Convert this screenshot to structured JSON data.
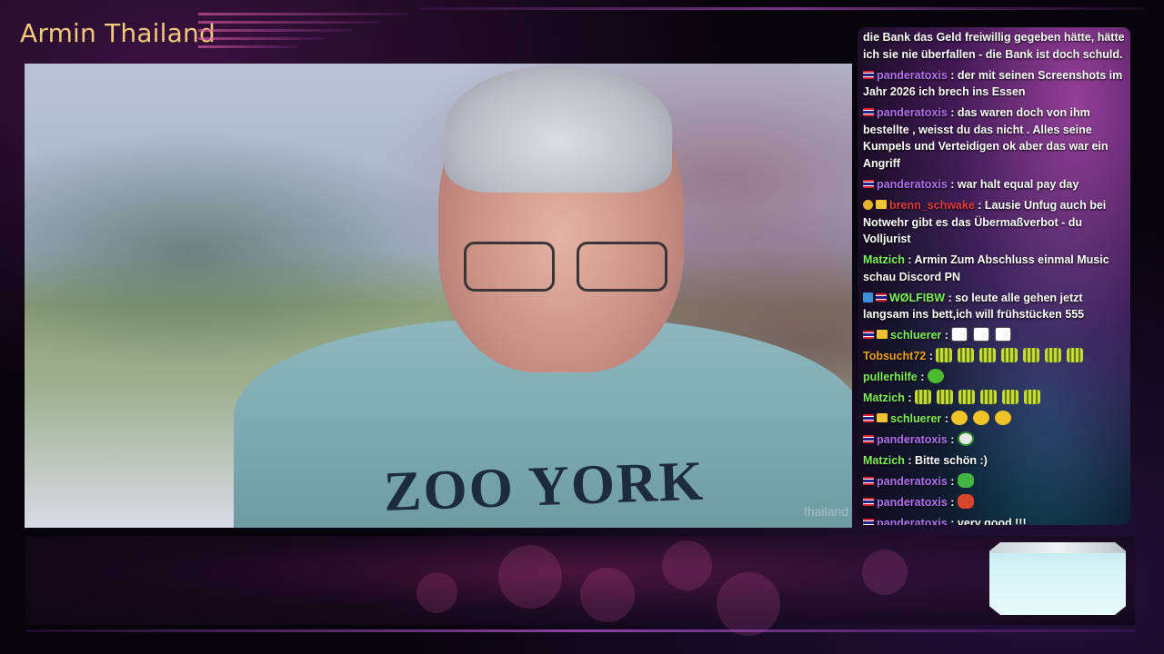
{
  "stream": {
    "title": "Armin Thailand",
    "watermark": "thailand",
    "shirt_text": "ZOO YORK"
  },
  "colors": {
    "title": "#f2c87a",
    "username_purple": "#b070f0",
    "username_green": "#7ff05a",
    "username_red": "#e23b3b",
    "username_orange": "#f0a020"
  },
  "chat": {
    "messages": [
      {
        "badges": [],
        "user": "",
        "color": "",
        "text": "die Bank das Geld freiwillig gegeben hätte, hätte ich sie nie überfallen - die Bank ist doch schuld."
      },
      {
        "badges": [
          "flag-th"
        ],
        "user": "panderatoxis",
        "color": "#b070f0",
        "text": " : der mit seinen Screenshots im Jahr 2026 ich brech ins Essen"
      },
      {
        "badges": [
          "flag-th"
        ],
        "user": "panderatoxis",
        "color": "#b070f0",
        "text": " : das waren doch von ihm bestellte , weisst du das nicht . Alles seine Kumpels und Verteidigen ok aber das war ein Angriff"
      },
      {
        "badges": [
          "flag-th"
        ],
        "user": "panderatoxis",
        "color": "#b070f0",
        "text": " : war halt equal pay day"
      },
      {
        "badges": [
          "badge-gold",
          "badge-crown"
        ],
        "user": "brenn_schwake",
        "color": "#e23b3b",
        "text": " : Lausie Unfug auch bei Notwehr gibt es das Übermaßverbot - du Volljurist"
      },
      {
        "badges": [],
        "user": "Matzich",
        "color": "#7ff05a",
        "text": " : Armin Zum Abschluss einmal Music schau Discord PN"
      },
      {
        "badges": [
          "badge-blue",
          "flag-th"
        ],
        "user": "WØLFIBW",
        "color": "#7ff05a",
        "text": " : so leute alle gehen jetzt langsam ins bett,ich will frühstücken 555"
      },
      {
        "badges": [
          "flag-th",
          "badge-crown"
        ],
        "user": "schluerer",
        "color": "#7ff05a",
        "text": " : ",
        "emotes": [
          "emote-cube",
          "emote-cube",
          "emote-cube"
        ]
      },
      {
        "badges": [],
        "user": "Tobsucht72",
        "color": "#f0a020",
        "text": " : ",
        "emotes": [
          "emote-bars",
          "emote-bars",
          "emote-bars",
          "emote-bars",
          "emote-bars",
          "emote-bars",
          "emote-bars"
        ]
      },
      {
        "badges": [],
        "user": "pullerhilfe",
        "color": "#7ff05a",
        "text": " : ",
        "emotes": [
          "emote-green"
        ]
      },
      {
        "badges": [],
        "user": "Matzich",
        "color": "#7ff05a",
        "text": " : ",
        "emotes": [
          "emote-bars",
          "emote-bars",
          "emote-bars",
          "emote-bars",
          "emote-bars",
          "emote-bars"
        ]
      },
      {
        "badges": [
          "flag-th",
          "badge-crown"
        ],
        "user": "schluerer",
        "color": "#7ff05a",
        "text": " : ",
        "emotes": [
          "emote-yellow",
          "emote-yellow",
          "emote-yellow"
        ]
      },
      {
        "badges": [
          "flag-th"
        ],
        "user": "panderatoxis",
        "color": "#b070f0",
        "text": " : ",
        "emotes": [
          "emote-face"
        ]
      },
      {
        "badges": [],
        "user": "Matzich",
        "color": "#7ff05a",
        "text": " : Bitte schön :)"
      },
      {
        "badges": [
          "flag-th"
        ],
        "user": "panderatoxis",
        "color": "#b070f0",
        "text": " : ",
        "emotes": [
          "emote-pepe"
        ]
      },
      {
        "badges": [
          "flag-th"
        ],
        "user": "panderatoxis",
        "color": "#b070f0",
        "text": " : ",
        "emotes": [
          "emote-red"
        ]
      },
      {
        "badges": [
          "flag-th"
        ],
        "user": "panderatoxis",
        "color": "#b070f0",
        "text": " : very good !!!"
      }
    ]
  }
}
